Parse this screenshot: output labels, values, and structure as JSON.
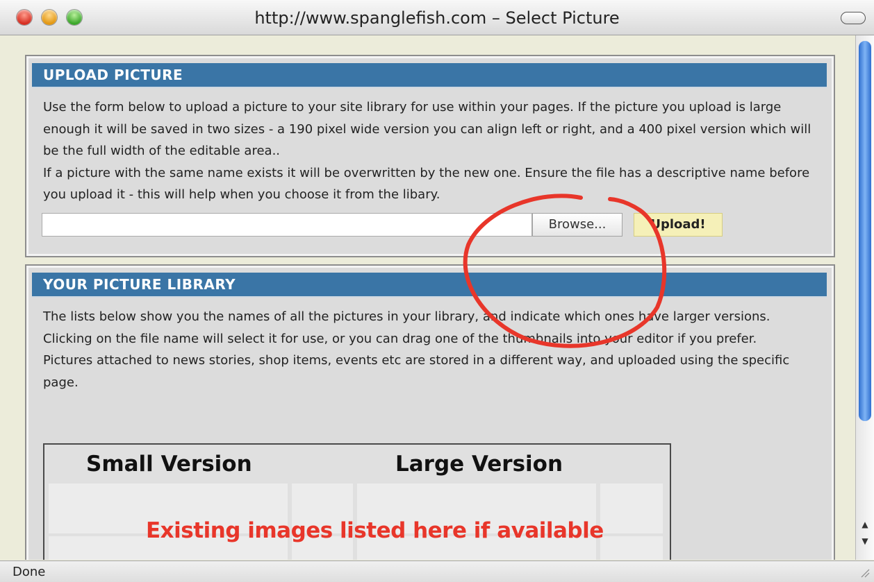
{
  "window": {
    "title": "http://www.spanglefish.com – Select Picture"
  },
  "upload_panel": {
    "header": "UPLOAD PICTURE",
    "paragraph1": "Use the form below to upload a picture to your site library for use within your pages. If the picture you upload is large enough it will be saved in two sizes - a 190 pixel wide version you can align left or right, and a 400 pixel version which will be the full width of the editable area..",
    "paragraph2": "If a picture with the same name exists it will be overwritten by the new one. Ensure the file has a descriptive name before you upload it - this will help when you choose it from the libary.",
    "file_value": "",
    "browse_label": "Browse...",
    "upload_label": "Upload!"
  },
  "library_panel": {
    "header": "YOUR PICTURE LIBRARY",
    "paragraph1": "The lists below show you the names of all the pictures in your library, and indicate which ones have larger versions. Clicking on the file name will select it for use, or you can drag one of the thumbnails into your editor if you prefer.",
    "paragraph2": "Pictures attached to news stories, shop items, events etc are stored in a different way, and uploaded using the specific page.",
    "small_version_heading": "Small Version",
    "large_version_heading": "Large Version",
    "placeholder_note": "Existing images listed here if available"
  },
  "status": {
    "text": "Done"
  },
  "colors": {
    "header_blue": "#3a75a6",
    "annotation_red": "#e8362a",
    "upload_button": "#f5f0b8"
  }
}
